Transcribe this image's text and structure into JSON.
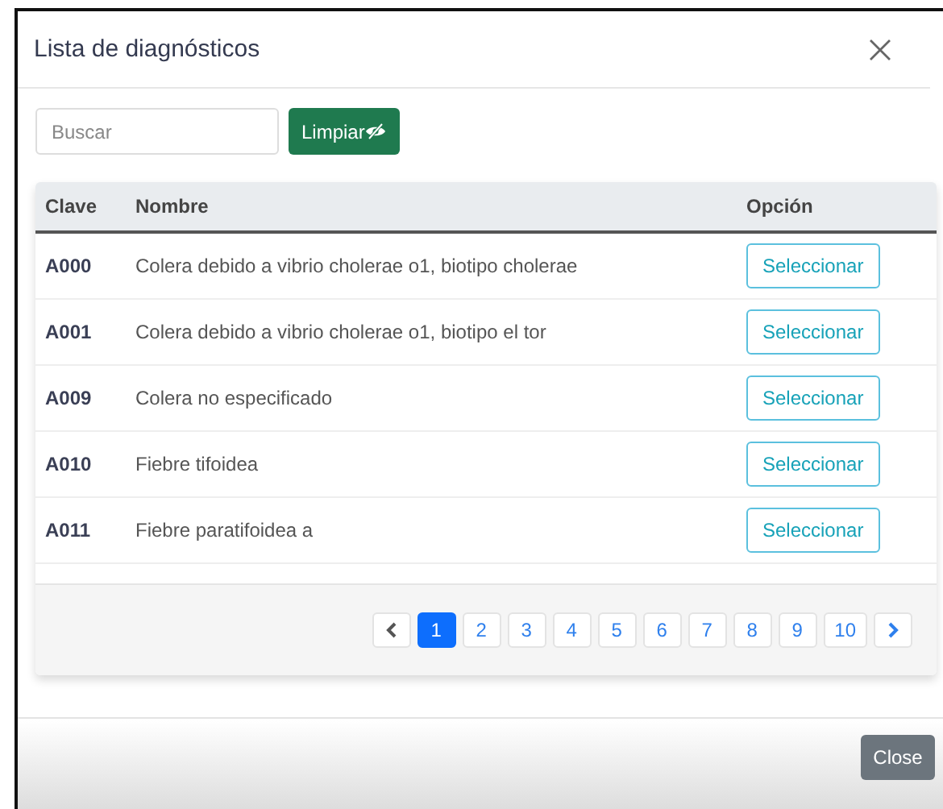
{
  "modal": {
    "title": "Lista de diagnósticos"
  },
  "search": {
    "placeholder": "Buscar"
  },
  "clear_button": {
    "label": "Limpiar"
  },
  "table": {
    "columns": [
      "Clave",
      "Nombre",
      "Opción"
    ],
    "rows": [
      {
        "code": "A000",
        "name": "Colera debido a vibrio cholerae o1, biotipo cholerae",
        "action": "Seleccionar"
      },
      {
        "code": "A001",
        "name": "Colera debido a vibrio cholerae o1, biotipo el tor",
        "action": "Seleccionar"
      },
      {
        "code": "A009",
        "name": "Colera no especificado",
        "action": "Seleccionar"
      },
      {
        "code": "A010",
        "name": "Fiebre tifoidea",
        "action": "Seleccionar"
      },
      {
        "code": "A011",
        "name": "Fiebre paratifoidea a",
        "action": "Seleccionar"
      }
    ]
  },
  "pagination": {
    "prev_disabled": true,
    "next_disabled": false,
    "pages": [
      {
        "label": "1",
        "selected": true
      },
      {
        "label": "2",
        "selected": false
      },
      {
        "label": "3",
        "selected": false
      },
      {
        "label": "4",
        "selected": false
      },
      {
        "label": "5",
        "selected": false
      },
      {
        "label": "6",
        "selected": false
      },
      {
        "label": "7",
        "selected": false
      },
      {
        "label": "8",
        "selected": false
      },
      {
        "label": "9",
        "selected": false
      },
      {
        "label": "10",
        "selected": false
      }
    ]
  },
  "footer": {
    "close_label": "Close"
  }
}
